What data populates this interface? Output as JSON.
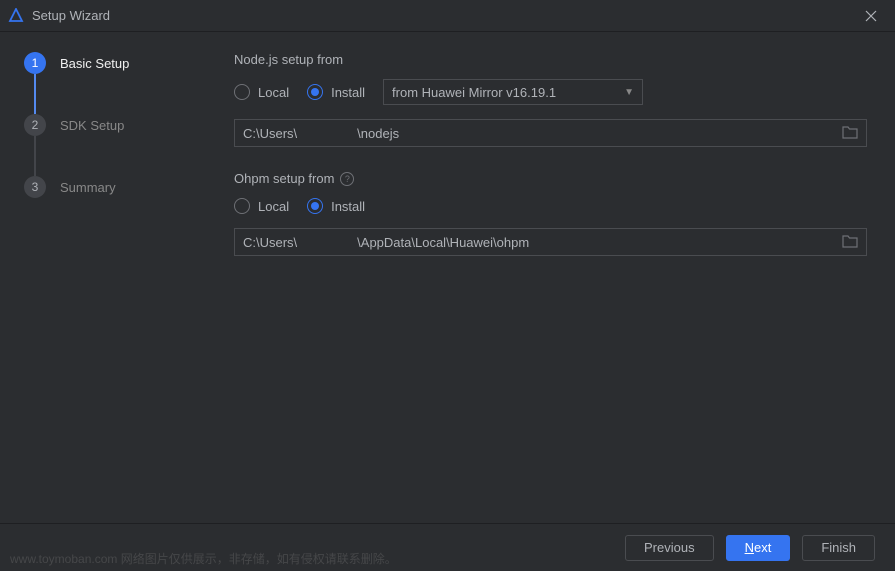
{
  "titlebar": {
    "title": "Setup Wizard"
  },
  "sidebar": {
    "steps": [
      {
        "number": "1",
        "label": "Basic Setup"
      },
      {
        "number": "2",
        "label": "SDK Setup"
      },
      {
        "number": "3",
        "label": "Summary"
      }
    ]
  },
  "content": {
    "nodejs": {
      "title": "Node.js setup from",
      "local_label": "Local",
      "install_label": "Install",
      "dropdown_value": "from Huawei Mirror v16.19.1",
      "path_prefix": "C:\\Users\\",
      "path_suffix": "\\nodejs"
    },
    "ohpm": {
      "title": "Ohpm setup from",
      "local_label": "Local",
      "install_label": "Install",
      "path_prefix": "C:\\Users\\",
      "path_suffix": "\\AppData\\Local\\Huawei\\ohpm"
    }
  },
  "footer": {
    "previous": "Previous",
    "next": "Next",
    "finish": "Finish",
    "watermark": "www.toymoban.com 网络图片仅供展示，非存储，如有侵权请联系删除。"
  }
}
